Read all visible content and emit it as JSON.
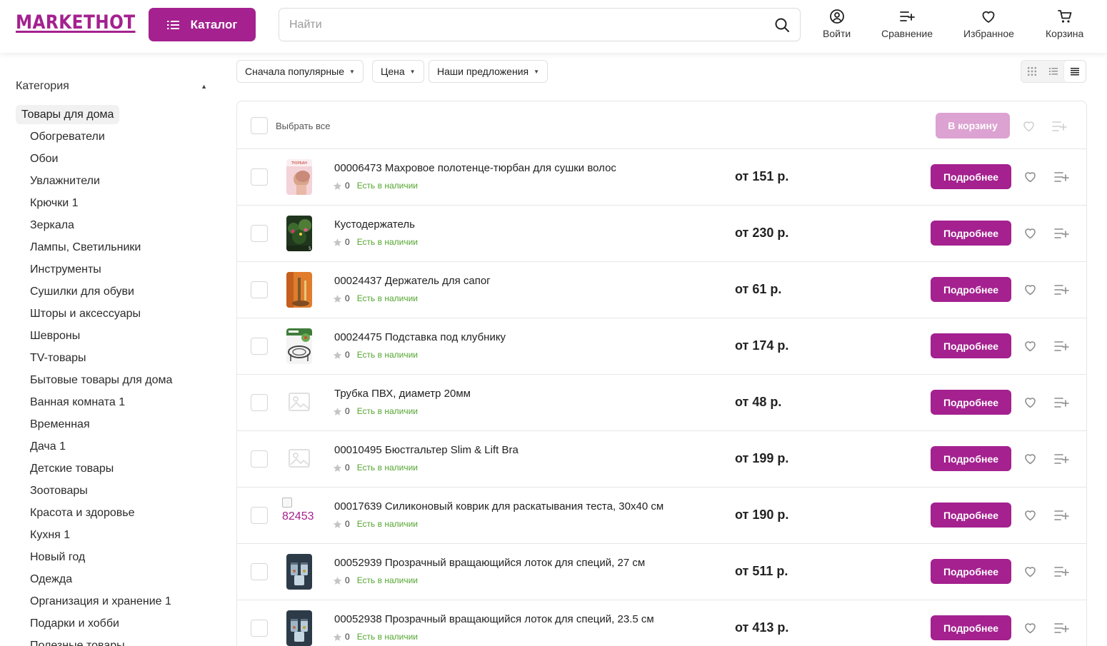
{
  "header": {
    "logo": "MARKETHOT",
    "catalog_label": "Каталог",
    "search_placeholder": "Найти",
    "search_value": "",
    "actions": {
      "login": "Войти",
      "compare": "Сравнение",
      "favorites": "Избранное",
      "cart": "Корзина"
    }
  },
  "filters": {
    "sort": "Сначала популярные",
    "price": "Цена",
    "offers": "Наши предложения"
  },
  "sidebar": {
    "heading": "Категория",
    "active": "Товары для дома",
    "items": [
      "Обогреватели",
      "Обои",
      "Увлажнители",
      "Крючки 1",
      "Зеркала",
      "Лампы, Светильники",
      "Инструменты",
      "Сушилки для обуви",
      "Шторы и аксессуары",
      "Шевроны",
      "TV-товары",
      "Бытовые товары для дома",
      "Ванная комната 1",
      "Временная",
      "Дача 1",
      "Детские товары",
      "Зоотовары",
      "Красота и здоровье",
      "Кухня 1",
      "Новый год",
      "Одежда",
      "Организация и хранение 1",
      "Подарки и хобби",
      "Полезные товары"
    ]
  },
  "list": {
    "select_all": "Выбрать все",
    "add_to_cart": "В корзину",
    "details_label": "Подробнее",
    "rating": "0",
    "stock": "Есть в наличии",
    "products": [
      {
        "title": "00006473 Махровое полотенце-тюрбан для сушки волос",
        "price": "от 151 р.",
        "image": "towel"
      },
      {
        "title": "Кустодержатель",
        "price": "от 230 р.",
        "image": "plants"
      },
      {
        "title": "00024437 Держатель для сапог",
        "price": "от 61 р.",
        "image": "boots"
      },
      {
        "title": "00024475 Подставка под клубнику",
        "price": "от 174 р.",
        "image": "stand"
      },
      {
        "title": "Трубка ПВХ, диаметр 20мм",
        "price": "от 48 р.",
        "image": "none"
      },
      {
        "title": "00010495 Бюстгальтер Slim & Lift Bra",
        "price": "от 199 р.",
        "image": "none"
      },
      {
        "title": "00017639 Силиконовый коврик для раскатывания теста, 30x40 см",
        "price": "от 190 р.",
        "image": "broken",
        "image_alt": "82453"
      },
      {
        "title": "00052939 Прозрачный вращающийся лоток для специй, 27 см",
        "price": "от 511 р.",
        "image": "jars"
      },
      {
        "title": "00052938 Прозрачный вращающийся лоток для специй, 23.5 см",
        "price": "от 413 р.",
        "image": "jars"
      }
    ]
  },
  "colors": {
    "brand": "#a4218f",
    "brand_disabled": "#dca2d1",
    "stock_green": "#55a630"
  }
}
